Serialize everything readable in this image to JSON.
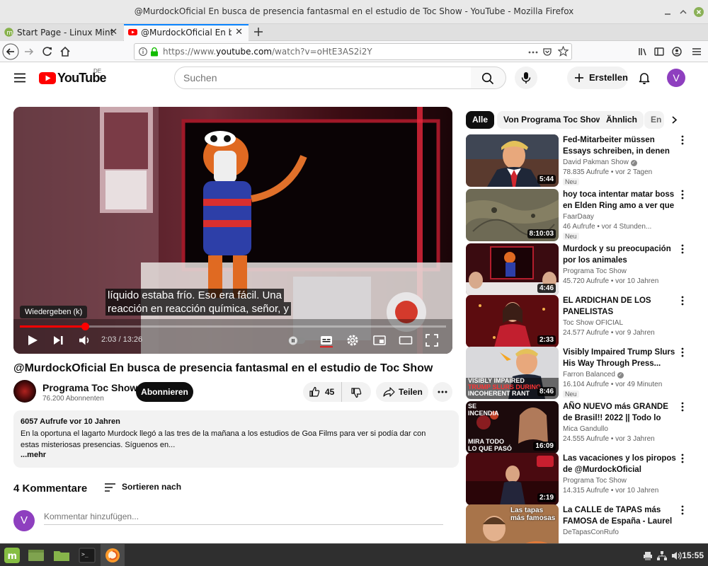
{
  "window": {
    "title": "@MurdockOficial En busca de presencia fantasmal en el estudio de Toc Show - YouTube - Mozilla Firefox"
  },
  "tabs": [
    {
      "label": "Start Page - Linux Mint",
      "active": false
    },
    {
      "label": "@MurdockOficial En busca",
      "active": true
    }
  ],
  "navbar": {
    "url_prefix": "https://www.",
    "url_domain": "youtube.com",
    "url_rest": "/watch?v=oHtE3AS2i2Y"
  },
  "youtube": {
    "logo": "YouTube",
    "region": "DE",
    "search_placeholder": "Suchen",
    "create_label": "Erstellen",
    "avatar_letter": "V"
  },
  "player": {
    "caption_line1": "líquido estaba frío. Eso era fácil. Una",
    "caption_line2": "reacción en reacción química, señor, y",
    "tooltip": "Wiedergeben (k)",
    "time_current": "2:03",
    "time_total": "13:26",
    "progress": 0.153
  },
  "video": {
    "title": "@MurdockOficial En busca de presencia fantasmal en el estudio de Toc Show",
    "channel": "Programa Toc Show",
    "subscribers": "76.200 Abonnenten",
    "subscribe_label": "Abonnieren",
    "likes": "45",
    "share_label": "Teilen"
  },
  "description": {
    "meta": "6057 Aufrufe  vor 10 Jahren",
    "text": "En la oportuna el lagarto Murdock llegó a las tres de la mañana a los estudios de Goa Films para ver si podía dar con estas misteriosas presencias. Síguenos en...",
    "more": "...mehr"
  },
  "comments": {
    "count_label": "4 Kommentare",
    "sort_label": "Sortieren nach",
    "avatar_letter": "V",
    "placeholder": "Kommentar hinzufügen..."
  },
  "chips": [
    "Alle",
    "Von Programa Toc Show",
    "Ähnlich",
    "En"
  ],
  "recommendations": [
    {
      "title": "Fed-Mitarbeiter müssen Essays schreiben, in denen sie Trump...",
      "channel": "David Pakman Show",
      "verified": true,
      "stats": "78.835 Aufrufe  • vor 2 Tagen",
      "badge": "Neu",
      "duration": "5:44"
    },
    {
      "title": "hoy toca intentar matar boss en Elden Ring amo a ver que sale",
      "channel": "FaarDaay",
      "verified": false,
      "stats": "46 Aufrufe  • vor 4 Stunden...",
      "badge": "Neu",
      "duration": "8:10:03"
    },
    {
      "title": "Murdock y su preocupación por los animales",
      "channel": "Programa Toc Show",
      "verified": false,
      "stats": "45.720 Aufrufe  • vor 10 Jahren",
      "badge": "",
      "duration": "4:46"
    },
    {
      "title": "EL ARDICHAN DE LOS PANELISTAS",
      "channel": "Toc Show OFICIAL",
      "verified": false,
      "stats": "24.577 Aufrufe  • vor 9 Jahren",
      "badge": "",
      "duration": "2:33"
    },
    {
      "title": "Visibly Impaired Trump Slurs His Way Through Press...",
      "channel": "Farron Balanced",
      "verified": true,
      "stats": "16.104 Aufrufe  • vor 49 Minuten",
      "badge": "Neu",
      "duration": "8:46",
      "thumb_text": [
        "VISIBLY IMPAIRED",
        "TRUMP SLURS DURING",
        "INCOHERENT RANT"
      ]
    },
    {
      "title": "AÑO NUEVO más GRANDE de Brasil!! 2022 || Todo lo que...",
      "channel": "Mica Gandullo",
      "verified": false,
      "stats": "24.555 Aufrufe  • vor 3 Jahren",
      "badge": "",
      "duration": "16:09",
      "thumb_text": [
        "SE",
        "INCENDIA",
        "MIRA TODO",
        "LO QUE PASÓ"
      ]
    },
    {
      "title": "Las vacaciones y los piropos de @MurdockOficial",
      "channel": "Programa Toc Show",
      "verified": false,
      "stats": "14.315 Aufrufe  • vor 10 Jahren",
      "badge": "",
      "duration": "2:19"
    },
    {
      "title": "La CALLE de TAPAS más FAMOSA de España - Laurel en...",
      "channel": "DeTapasConRufo",
      "verified": false,
      "stats": "",
      "badge": "",
      "duration": "",
      "thumb_text": [
        "Las tapas",
        "más famosas"
      ]
    }
  ],
  "taskbar": {
    "clock": "15:55"
  },
  "colors": {
    "youtube_red": "#ff0000",
    "firefox_blue": "#0a84ff",
    "avatar_purple": "#8e3fbf"
  }
}
